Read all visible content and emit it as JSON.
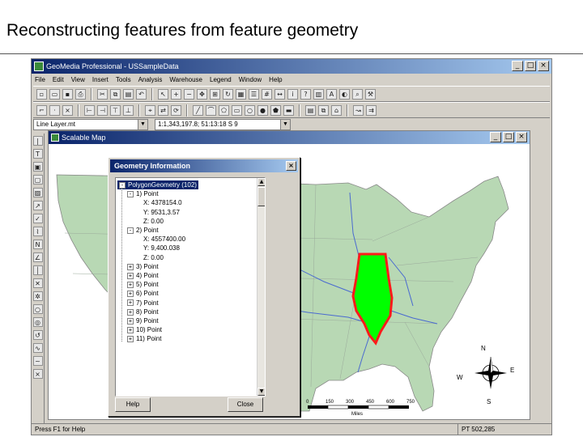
{
  "slide": {
    "title": "Reconstructing features from feature geometry"
  },
  "app": {
    "title": "GeoMedia Professional - USSampleData",
    "menus": [
      "File",
      "Edit",
      "View",
      "Insert",
      "Tools",
      "Analysis",
      "Warehouse",
      "Legend",
      "Window",
      "Help"
    ],
    "layer_select": {
      "value": "Line Layer.mt"
    },
    "scale_select": {
      "value": "1:1,343,197.8; 51:13:18 S 9"
    },
    "status_left": "Press F1 for Help",
    "status_right": "PT 502,285"
  },
  "map_window": {
    "title": "Scalable Map",
    "highlight_fill": "#00ff00",
    "highlight_stroke": "#ff1a1a",
    "land_color": "#b8d8b4",
    "compass": {
      "n": "N",
      "e": "E",
      "w": "W",
      "s": "S"
    },
    "scalebar": {
      "ticks": [
        "0",
        "150",
        "300",
        "450",
        "600",
        "750"
      ],
      "unit": "Miles"
    }
  },
  "dialog": {
    "title": "Geometry Information",
    "buttons": {
      "help": "Help",
      "close": "Close"
    },
    "tree": [
      {
        "level": 0,
        "expander": "-",
        "text": "PolygonGeometry (102)",
        "selected": true
      },
      {
        "level": 1,
        "expander": "-",
        "text": "1) Point"
      },
      {
        "level": 2,
        "expander": "",
        "text": "X: 4378154.0"
      },
      {
        "level": 2,
        "expander": "",
        "text": "Y: 9531,3.57"
      },
      {
        "level": 2,
        "expander": "",
        "text": "Z: 0.00"
      },
      {
        "level": 1,
        "expander": "-",
        "text": "2) Point"
      },
      {
        "level": 2,
        "expander": "",
        "text": "X: 4557400.00"
      },
      {
        "level": 2,
        "expander": "",
        "text": "Y: 9,400.038"
      },
      {
        "level": 2,
        "expander": "",
        "text": "Z: 0.00"
      },
      {
        "level": 1,
        "expander": "+",
        "text": "3) Point"
      },
      {
        "level": 1,
        "expander": "+",
        "text": "4) Point"
      },
      {
        "level": 1,
        "expander": "+",
        "text": "5) Point"
      },
      {
        "level": 1,
        "expander": "+",
        "text": "6) Point"
      },
      {
        "level": 1,
        "expander": "+",
        "text": "7) Point"
      },
      {
        "level": 1,
        "expander": "+",
        "text": "8) Point"
      },
      {
        "level": 1,
        "expander": "+",
        "text": "9) Point"
      },
      {
        "level": 1,
        "expander": "+",
        "text": "10) Point"
      },
      {
        "level": 1,
        "expander": "+",
        "text": "11) Point"
      }
    ]
  }
}
